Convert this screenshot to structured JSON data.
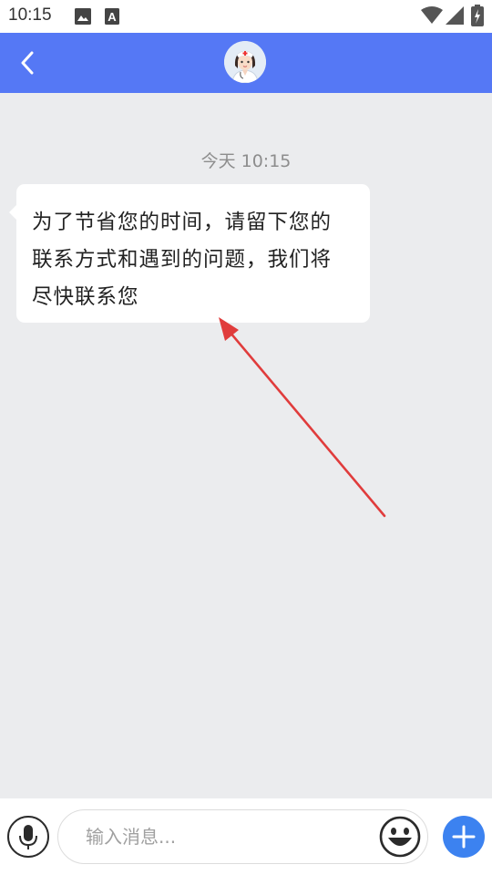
{
  "status_bar": {
    "time": "10:15",
    "icons": [
      "image-icon",
      "a-badge-icon",
      "wifi-icon",
      "signal-icon",
      "battery-icon"
    ]
  },
  "app_bar": {
    "back_icon": "chevron-left-icon",
    "avatar": "nurse-avatar",
    "background_color": "#5578f5"
  },
  "chat": {
    "timestamp": "今天 10:15",
    "messages": [
      {
        "text": "为了节省您的时间，请留下您的联系方式和遇到的问题，我们将尽快联系您"
      }
    ]
  },
  "annotation": {
    "arrow_color": "#e03c3c"
  },
  "input_bar": {
    "placeholder": "输入消息...",
    "mic_icon": "microphone-icon",
    "emoji_icon": "smiley-icon",
    "plus_icon": "plus-icon",
    "plus_color": "#3c82f0"
  }
}
